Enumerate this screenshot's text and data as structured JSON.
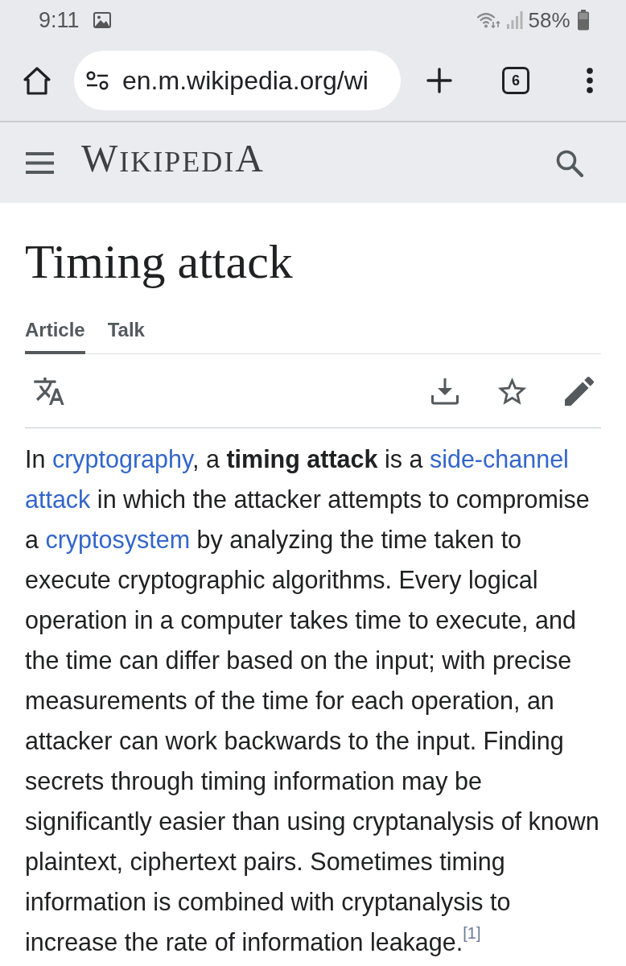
{
  "status_bar": {
    "time": "9:11",
    "battery": "58%"
  },
  "browser_toolbar": {
    "url": "en.m.wikipedia.org/wi",
    "tab_count": "6"
  },
  "site_header": {
    "logo": "WIKIPEDIA"
  },
  "article": {
    "title": "Timing attack",
    "tabs": [
      {
        "label": "Article",
        "selected": true
      },
      {
        "label": "Talk",
        "selected": false
      }
    ],
    "lead_paragraph": [
      {
        "kind": "text",
        "text": "In "
      },
      {
        "kind": "link",
        "text": "cryptography"
      },
      {
        "kind": "text",
        "text": ", a **timing attack** is a "
      },
      {
        "kind": "link",
        "text": "side-channel"
      },
      {
        "kind": "link",
        "text": "attack"
      },
      {
        "kind": "text",
        "text": " in which the attacker attempts to compromise a "
      },
      {
        "kind": "link",
        "text": "cryptosystem"
      },
      {
        "kind": "text",
        "text": " by analyzing the time taken to execute cryptographic algorithms. Every logical operation in a computer takes time to execute, and the time can differ based on the input; with precise measurements of the time for each operation, an attacker can work backwards to the input. Finding secrets through timing information may be significantly easier than using cryptanalysis of known plaintext, ciphertext pairs. Sometimes timing information is combined with cryptanalysis to increase the rate of information leakage."
      },
      {
        "kind": "citation",
        "text": "[1]"
      }
    ]
  }
}
